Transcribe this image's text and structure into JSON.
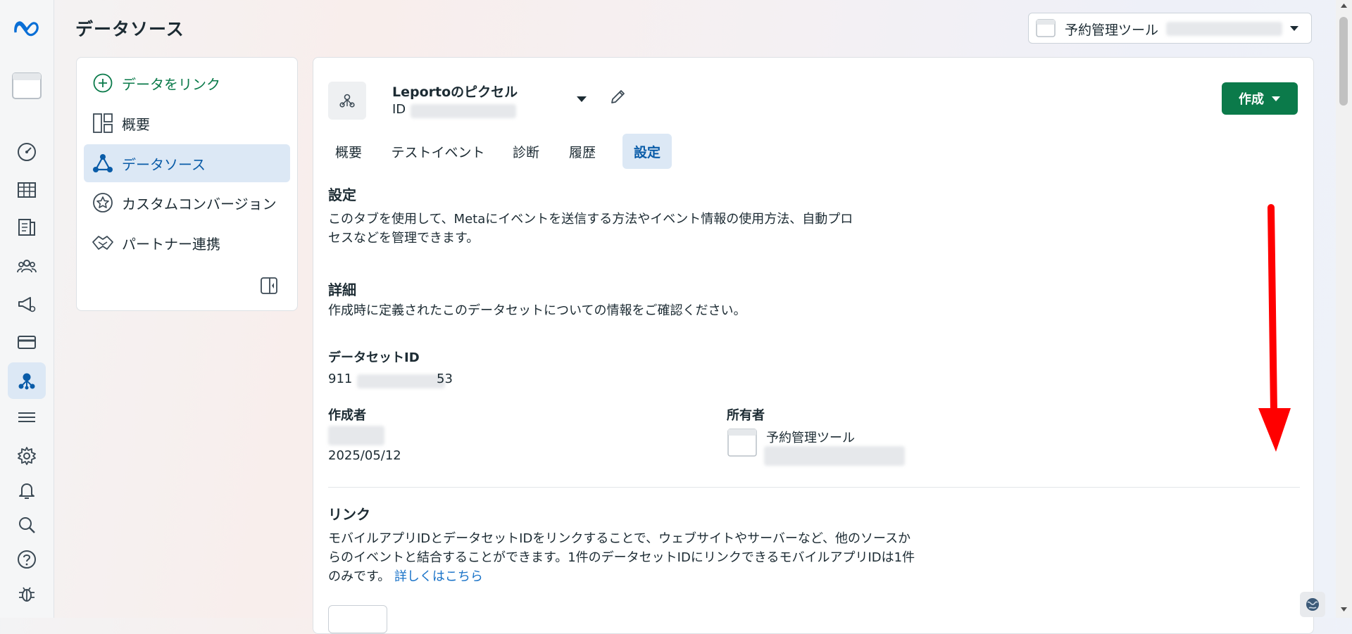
{
  "header": {
    "page_title": "データソース",
    "account_label": "予約管理ツール"
  },
  "nav": {
    "link_data": "データをリンク",
    "items": [
      {
        "label": "概要",
        "icon": "overview-icon"
      },
      {
        "label": "データソース",
        "icon": "data-source-icon"
      },
      {
        "label": "カスタムコンバージョン",
        "icon": "star-icon"
      },
      {
        "label": "パートナー連携",
        "icon": "handshake-icon"
      }
    ],
    "active_index": 1
  },
  "pixel": {
    "name": "Leportoのピクセル",
    "id_label": "ID",
    "create_label": "作成"
  },
  "tabs": [
    "概要",
    "テストイベント",
    "診断",
    "履歴",
    "設定"
  ],
  "active_tab": 4,
  "settings": {
    "title": "設定",
    "description_line1": "このタブを使用して、Metaにイベントを送信する方法やイベント情報の使用方法、自動プロ",
    "description_line2": "セスなどを管理できます。"
  },
  "details": {
    "title": "詳細",
    "description": "作成時に定義されたこのデータセットについての情報をご確認ください。",
    "dataset_id_label": "データセットID",
    "dataset_id_prefix": "911",
    "dataset_id_suffix": "53",
    "creator_label": "作成者",
    "created_date": "2025/05/12",
    "owner_label": "所有者",
    "owner_name": "予約管理ツール"
  },
  "link_section": {
    "title": "リンク",
    "line1": "モバイルアプリIDとデータセットIDをリンクすることで、ウェブサイトやサーバーなど、他のソースか",
    "line2": "らのイベントと結合することができます。1件のデータセットIDにリンクできるモバイルアプリIDは1件",
    "line3_text": "のみです。",
    "learn_more": "詳しくはこちら"
  },
  "colors": {
    "accent_green": "#0b7a4a",
    "active_blue": "#0a5ca8",
    "arrow_red": "#ff0000"
  }
}
